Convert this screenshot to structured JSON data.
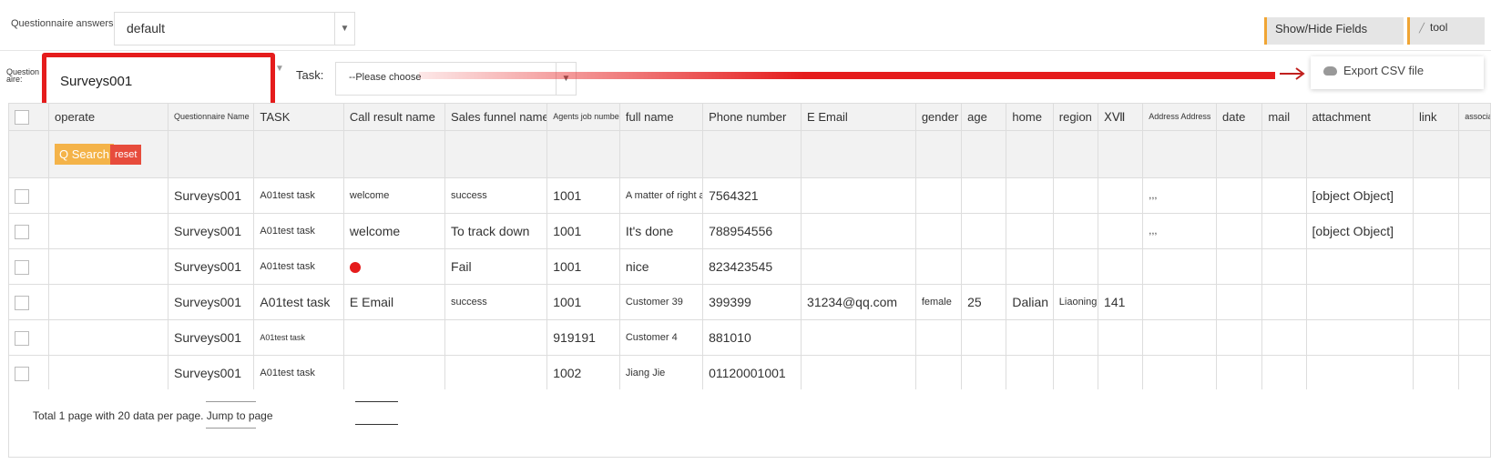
{
  "top": {
    "answers_label": "Questionnaire answers",
    "answers_value": "default",
    "show_hide_fields": "Show/Hide Fields",
    "tool": "tool",
    "export_csv": "Export CSV file"
  },
  "filters": {
    "questionnaire_label_1": "Question",
    "questionnaire_label_2": "aire:",
    "questionnaire_value": "Surveys001",
    "task_label": "Task:",
    "task_value": "--Please choose"
  },
  "colors": {
    "highlight": "#e51c1c",
    "accent": "#f0a534",
    "search": "#f4b349",
    "reset": "#e74c3c"
  },
  "table": {
    "columns": [
      "operate",
      "Questionnaire Name",
      "TASK",
      "Call result name",
      "Sales funnel name",
      "Agents job number",
      "full name",
      "Phone number",
      "E Email",
      "gender",
      "age",
      "home",
      "region",
      "ⅩⅦ",
      "Address Address",
      "date",
      "mail",
      "attachment",
      "link",
      "association"
    ],
    "search_label": "Q Search",
    "reset_label": "reset",
    "rows": [
      [
        "",
        "Surveys001",
        "A01test task",
        "welcome",
        "success",
        "1001",
        "A matter of right and wrong",
        "7564321",
        "",
        "",
        "",
        "",
        "",
        "",
        ",,,",
        "",
        "",
        "[object Object]",
        "",
        ""
      ],
      [
        "",
        "Surveys001",
        "A01test task",
        "welcome",
        "To track down",
        "1001",
        "It's done",
        "788954556",
        "",
        "",
        "",
        "",
        "",
        "",
        ",,,",
        "",
        "",
        "[object Object]",
        "",
        ""
      ],
      [
        "",
        "Surveys001",
        "A01test task",
        "",
        "Fail",
        "1001",
        "nice",
        "823423545",
        "",
        "",
        "",
        "",
        "",
        "",
        "",
        "",
        "",
        "",
        "",
        ""
      ],
      [
        "",
        "Surveys001",
        "A01test task",
        "E Email",
        "success",
        "1001",
        "Customer 39",
        "399399",
        "31234@qq.com",
        "female",
        "25",
        "Dalian",
        "Liaoning",
        "141",
        "",
        "",
        "",
        "",
        "",
        ""
      ],
      [
        "",
        "Surveys001",
        "A01test task",
        "",
        "",
        "919191",
        "Customer 4",
        "881010",
        "",
        "",
        "",
        "",
        "",
        "",
        "",
        "",
        "",
        "",
        "",
        ""
      ],
      [
        "",
        "Surveys001",
        "A01test task",
        "",
        "",
        "1002",
        "Jiang Jie",
        "01120001001",
        "",
        "",
        "",
        "",
        "",
        "",
        "",
        "",
        "",
        "",
        "",
        ""
      ]
    ]
  },
  "footer": {
    "summary": "Total 1 page with 20 data per page. Jump to page"
  }
}
